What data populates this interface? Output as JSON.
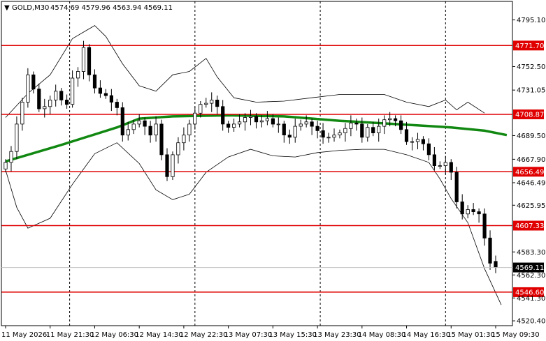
{
  "header": {
    "arrow": "▼",
    "symbol": "GOLD,M30",
    "ohlc": "4574.69 4579.96 4563.94 4569.11"
  },
  "colors": {
    "level_line": "#e00000",
    "moving_average": "#118811",
    "bands": "#000000",
    "candle": "#000000",
    "grid": "#000000",
    "price_box": "#000000"
  },
  "chart_data": {
    "type": "candlestick",
    "title": "GOLD,M30",
    "timeframe": "M30",
    "last_bar_ohlc": {
      "open": 4574.69,
      "high": 4579.96,
      "low": 4563.94,
      "close": 4569.11
    },
    "current_price_label": "4569.11",
    "ylim": [
      4516,
      4812
    ],
    "y_ticks": [
      "4795.10",
      "4752.50",
      "4731.05",
      "4689.50",
      "4667.90",
      "4646.49",
      "4625.95",
      "4583.30",
      "4562.30",
      "4541.30",
      "4520.40"
    ],
    "x_ticks": [
      "11 May 2026",
      "11 May 21:30",
      "12 May 06:30",
      "12 May 14:30",
      "12 May 22:30",
      "13 May 07:30",
      "13 May 15:30",
      "13 May 23:30",
      "14 May 08:30",
      "14 May 16:30",
      "15 May 01:30",
      "15 May 09:30"
    ],
    "x_tick_pos": [
      0,
      8,
      16,
      24,
      32,
      40,
      48,
      56,
      64,
      72,
      80,
      88
    ],
    "day_separators": [
      11.5,
      34,
      56.5,
      79
    ],
    "levels": [
      {
        "label": "4771.70",
        "value": 4771.7
      },
      {
        "label": "4708.87",
        "value": 4708.87
      },
      {
        "label": "4656.49",
        "value": 4656.49
      },
      {
        "label": "4607.33",
        "value": 4607.33
      },
      {
        "label": "4546.60",
        "value": 4546.6
      }
    ],
    "closes": [
      4665,
      4675,
      4700,
      4720,
      4745,
      4732,
      4714,
      4716,
      4722,
      4730,
      4722,
      4718,
      4742,
      4748,
      4770,
      4745,
      4733,
      4728,
      4726,
      4720,
      4715,
      4690,
      4695,
      4700,
      4703,
      4698,
      4690,
      4700,
      4672,
      4652,
      4672,
      4683,
      4690,
      4700,
      4710,
      4718,
      4719,
      4722,
      4716,
      4700,
      4697,
      4700,
      4702,
      4706,
      4707,
      4702,
      4703,
      4705,
      4700,
      4700,
      4690,
      4688,
      4698,
      4700,
      4702,
      4698,
      4694,
      4688,
      4688,
      4690,
      4692,
      4696,
      4701,
      4700,
      4688,
      4697,
      4692,
      4698,
      4704,
      4705,
      4703,
      4695,
      4684,
      4684,
      4686,
      4682,
      4672,
      4662,
      4662,
      4665,
      4656,
      4629,
      4618,
      4622,
      4620,
      4618,
      4596,
      4573,
      4569
    ],
    "moving_average": [
      [
        0,
        4666
      ],
      [
        10,
        4681
      ],
      [
        20,
        4697
      ],
      [
        24,
        4705
      ],
      [
        30,
        4707
      ],
      [
        40,
        4708
      ],
      [
        50,
        4707
      ],
      [
        60,
        4703
      ],
      [
        70,
        4700
      ],
      [
        80,
        4697
      ],
      [
        86,
        4694
      ],
      [
        90,
        4690
      ]
    ],
    "band_upper": [
      [
        0,
        4706
      ],
      [
        4,
        4728
      ],
      [
        8,
        4745
      ],
      [
        12,
        4778
      ],
      [
        16,
        4790
      ],
      [
        18,
        4780
      ],
      [
        21,
        4755
      ],
      [
        24,
        4735
      ],
      [
        27,
        4730
      ],
      [
        30,
        4745
      ],
      [
        33,
        4748
      ],
      [
        36,
        4760
      ],
      [
        38,
        4743
      ],
      [
        41,
        4724
      ],
      [
        45,
        4720
      ],
      [
        50,
        4721
      ],
      [
        55,
        4724
      ],
      [
        60,
        4727
      ],
      [
        64,
        4727
      ],
      [
        68,
        4727
      ],
      [
        72,
        4720
      ],
      [
        76,
        4716
      ],
      [
        79,
        4722
      ],
      [
        81,
        4713
      ],
      [
        83,
        4720
      ],
      [
        86,
        4710
      ]
    ],
    "band_lower": [
      [
        0,
        4658
      ],
      [
        2,
        4624
      ],
      [
        4,
        4605
      ],
      [
        8,
        4614
      ],
      [
        12,
        4645
      ],
      [
        16,
        4673
      ],
      [
        20,
        4683
      ],
      [
        24,
        4664
      ],
      [
        27,
        4640
      ],
      [
        30,
        4631
      ],
      [
        33,
        4636
      ],
      [
        36,
        4656
      ],
      [
        40,
        4670
      ],
      [
        44,
        4677
      ],
      [
        48,
        4671
      ],
      [
        52,
        4670
      ],
      [
        56,
        4674
      ],
      [
        60,
        4676
      ],
      [
        64,
        4677
      ],
      [
        68,
        4677
      ],
      [
        72,
        4672
      ],
      [
        76,
        4665
      ],
      [
        78,
        4650
      ],
      [
        80,
        4632
      ],
      [
        83,
        4610
      ],
      [
        86,
        4568
      ],
      [
        89,
        4535
      ]
    ]
  }
}
